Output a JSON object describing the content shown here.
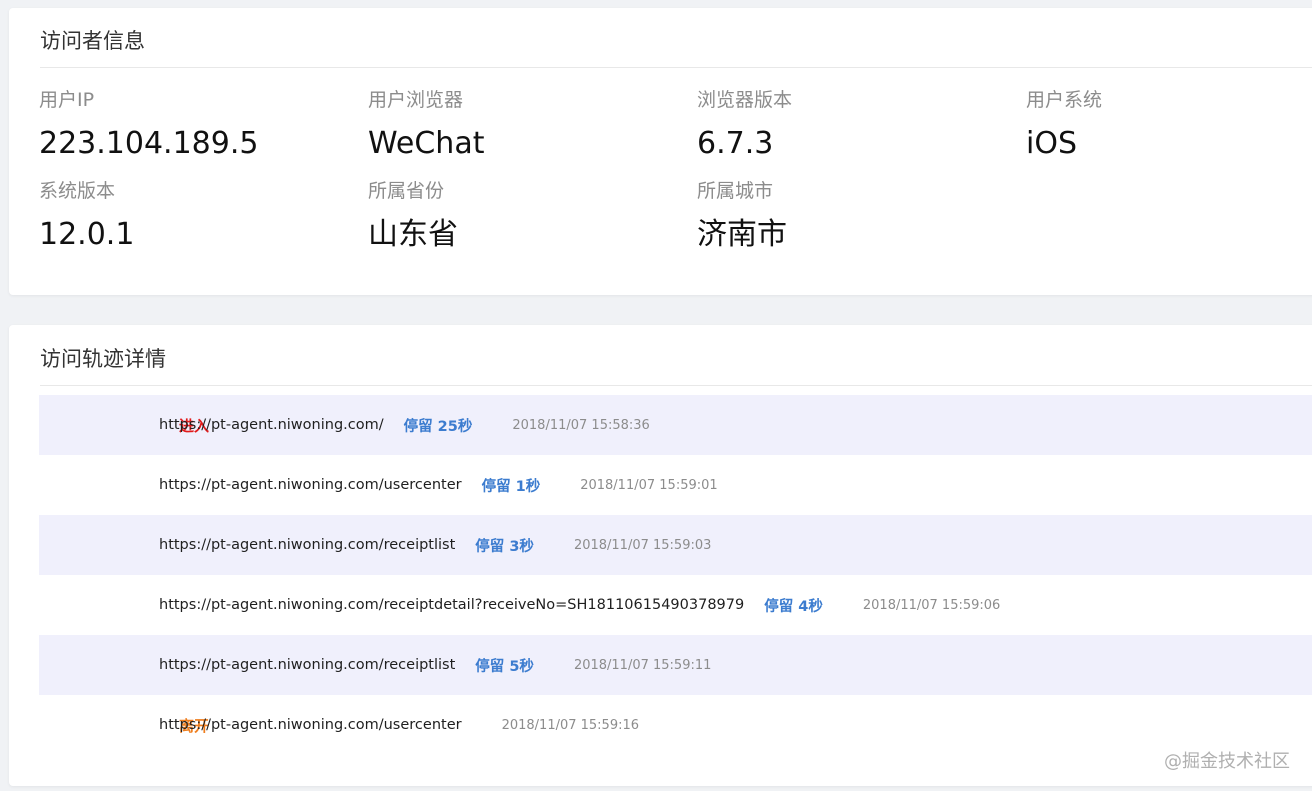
{
  "visitor": {
    "title": "访问者信息",
    "items": [
      {
        "label": "用户IP",
        "value": "223.104.189.5"
      },
      {
        "label": "用户浏览器",
        "value": "WeChat"
      },
      {
        "label": "浏览器版本",
        "value": "6.7.3"
      },
      {
        "label": "用户系统",
        "value": "iOS"
      },
      {
        "label": "系统版本",
        "value": "12.0.1"
      },
      {
        "label": "所属省份",
        "value": "山东省"
      },
      {
        "label": "所属城市",
        "value": "济南市"
      }
    ]
  },
  "track": {
    "title": "访问轨迹详情",
    "rows": [
      {
        "tag": "进入",
        "tag_type": "enter",
        "url": "https://pt-agent.niwoning.com/",
        "stay": "停留 25秒",
        "time": "2018/11/07 15:58:36"
      },
      {
        "tag": "",
        "tag_type": "",
        "url": "https://pt-agent.niwoning.com/usercenter",
        "stay": "停留 1秒",
        "time": "2018/11/07 15:59:01"
      },
      {
        "tag": "",
        "tag_type": "",
        "url": "https://pt-agent.niwoning.com/receiptlist",
        "stay": "停留 3秒",
        "time": "2018/11/07 15:59:03"
      },
      {
        "tag": "",
        "tag_type": "",
        "url": "https://pt-agent.niwoning.com/receiptdetail?receiveNo=SH18110615490378979",
        "stay": "停留 4秒",
        "time": "2018/11/07 15:59:06"
      },
      {
        "tag": "",
        "tag_type": "",
        "url": "https://pt-agent.niwoning.com/receiptlist",
        "stay": "停留 5秒",
        "time": "2018/11/07 15:59:11"
      },
      {
        "tag": "离开",
        "tag_type": "leave",
        "url": "https://pt-agent.niwoning.com/usercenter",
        "stay": "",
        "time": "2018/11/07 15:59:16"
      }
    ]
  },
  "watermark": "@掘金技术社区",
  "colors": {
    "enter": "#e11b1b",
    "leave": "#ef7e1e",
    "stay": "#3c7ccf",
    "alt_row_bg": "#f0f0fc"
  }
}
